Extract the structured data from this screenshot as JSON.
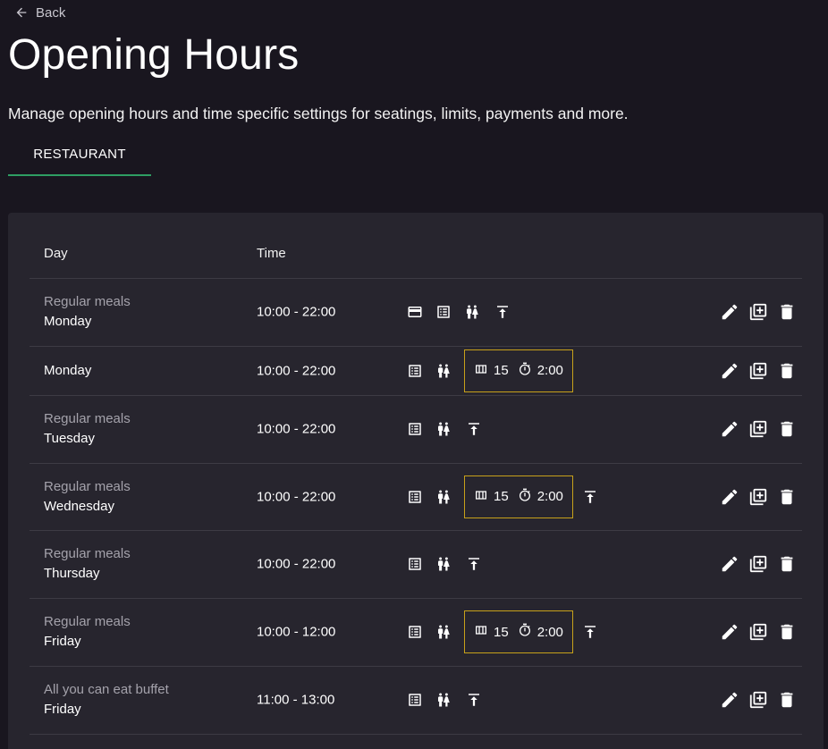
{
  "nav": {
    "back_label": "Back"
  },
  "page": {
    "title": "Opening Hours",
    "subtitle": "Manage opening hours and time specific settings for seatings, limits, payments and more."
  },
  "tabs": [
    {
      "label": "RESTAURANT",
      "active": true
    }
  ],
  "table": {
    "headers": {
      "day": "Day",
      "time": "Time"
    },
    "rows": [
      {
        "meal": "Regular meals",
        "day": "Monday",
        "time": "10:00 - 22:00",
        "icons": [
          "payment-card-icon",
          "menu-list-icon",
          "guests-icon",
          "max-upload-icon"
        ],
        "limits": null
      },
      {
        "meal": "",
        "day": "Monday",
        "time": "10:00 - 22:00",
        "icons": [
          "menu-list-icon",
          "guests-icon"
        ],
        "limits": {
          "tables": "15",
          "duration": "2:00"
        },
        "after": []
      },
      {
        "meal": "Regular meals",
        "day": "Tuesday",
        "time": "10:00 - 22:00",
        "icons": [
          "menu-list-icon",
          "guests-icon",
          "max-upload-icon"
        ],
        "limits": null
      },
      {
        "meal": "Regular meals",
        "day": "Wednesday",
        "time": "10:00 - 22:00",
        "icons": [
          "menu-list-icon",
          "guests-icon"
        ],
        "limits": {
          "tables": "15",
          "duration": "2:00"
        },
        "after": [
          "max-upload-icon"
        ]
      },
      {
        "meal": "Regular meals",
        "day": "Thursday",
        "time": "10:00 - 22:00",
        "icons": [
          "menu-list-icon",
          "guests-icon",
          "max-upload-icon"
        ],
        "limits": null
      },
      {
        "meal": "Regular meals",
        "day": "Friday",
        "time": "10:00 - 12:00",
        "icons": [
          "menu-list-icon",
          "guests-icon"
        ],
        "limits": {
          "tables": "15",
          "duration": "2:00"
        },
        "after": [
          "max-upload-icon"
        ]
      },
      {
        "meal": "All you can eat buffet",
        "day": "Friday",
        "time": "11:00 - 13:00",
        "icons": [
          "menu-list-icon",
          "guests-icon",
          "max-upload-icon"
        ],
        "limits": null
      }
    ],
    "row_actions": [
      "edit-icon",
      "duplicate-icon",
      "delete-icon"
    ]
  },
  "colors": {
    "background": "#19161f",
    "panel": "#27252e",
    "tab_indicator": "#2e9e63",
    "highlight_border": "#c7a11a",
    "muted_text": "#a4a2ab"
  }
}
